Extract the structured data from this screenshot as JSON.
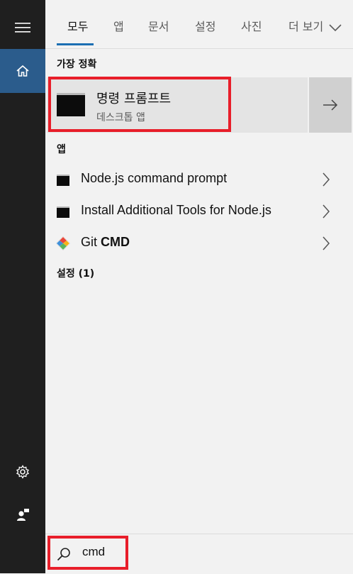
{
  "tabs": [
    {
      "label": "모두",
      "selected": true
    },
    {
      "label": "앱"
    },
    {
      "label": "문서"
    },
    {
      "label": "설정"
    },
    {
      "label": "사진"
    },
    {
      "label": "더 보기"
    }
  ],
  "best_match": {
    "section_title": "가장 정확",
    "title": "명령 프롬프트",
    "subtitle": "데스크톱 앱",
    "icon": "command-prompt-icon"
  },
  "apps": {
    "section_title": "앱",
    "items": [
      {
        "label": "Node.js command prompt",
        "icon": "command-prompt-icon"
      },
      {
        "label": "Install Additional Tools for Node.js",
        "icon": "command-prompt-icon"
      },
      {
        "label_prefix": "Git ",
        "label_bold": "CMD",
        "icon": "git-icon"
      }
    ]
  },
  "settings": {
    "section_title": "설정 (1)"
  },
  "search": {
    "value": "cmd",
    "icon": "search-icon"
  },
  "colors": {
    "accent": "#1c6fb3",
    "highlight": "#e81e2a",
    "rail": "#1f1f1f",
    "rail_active": "#2b5c8c"
  }
}
